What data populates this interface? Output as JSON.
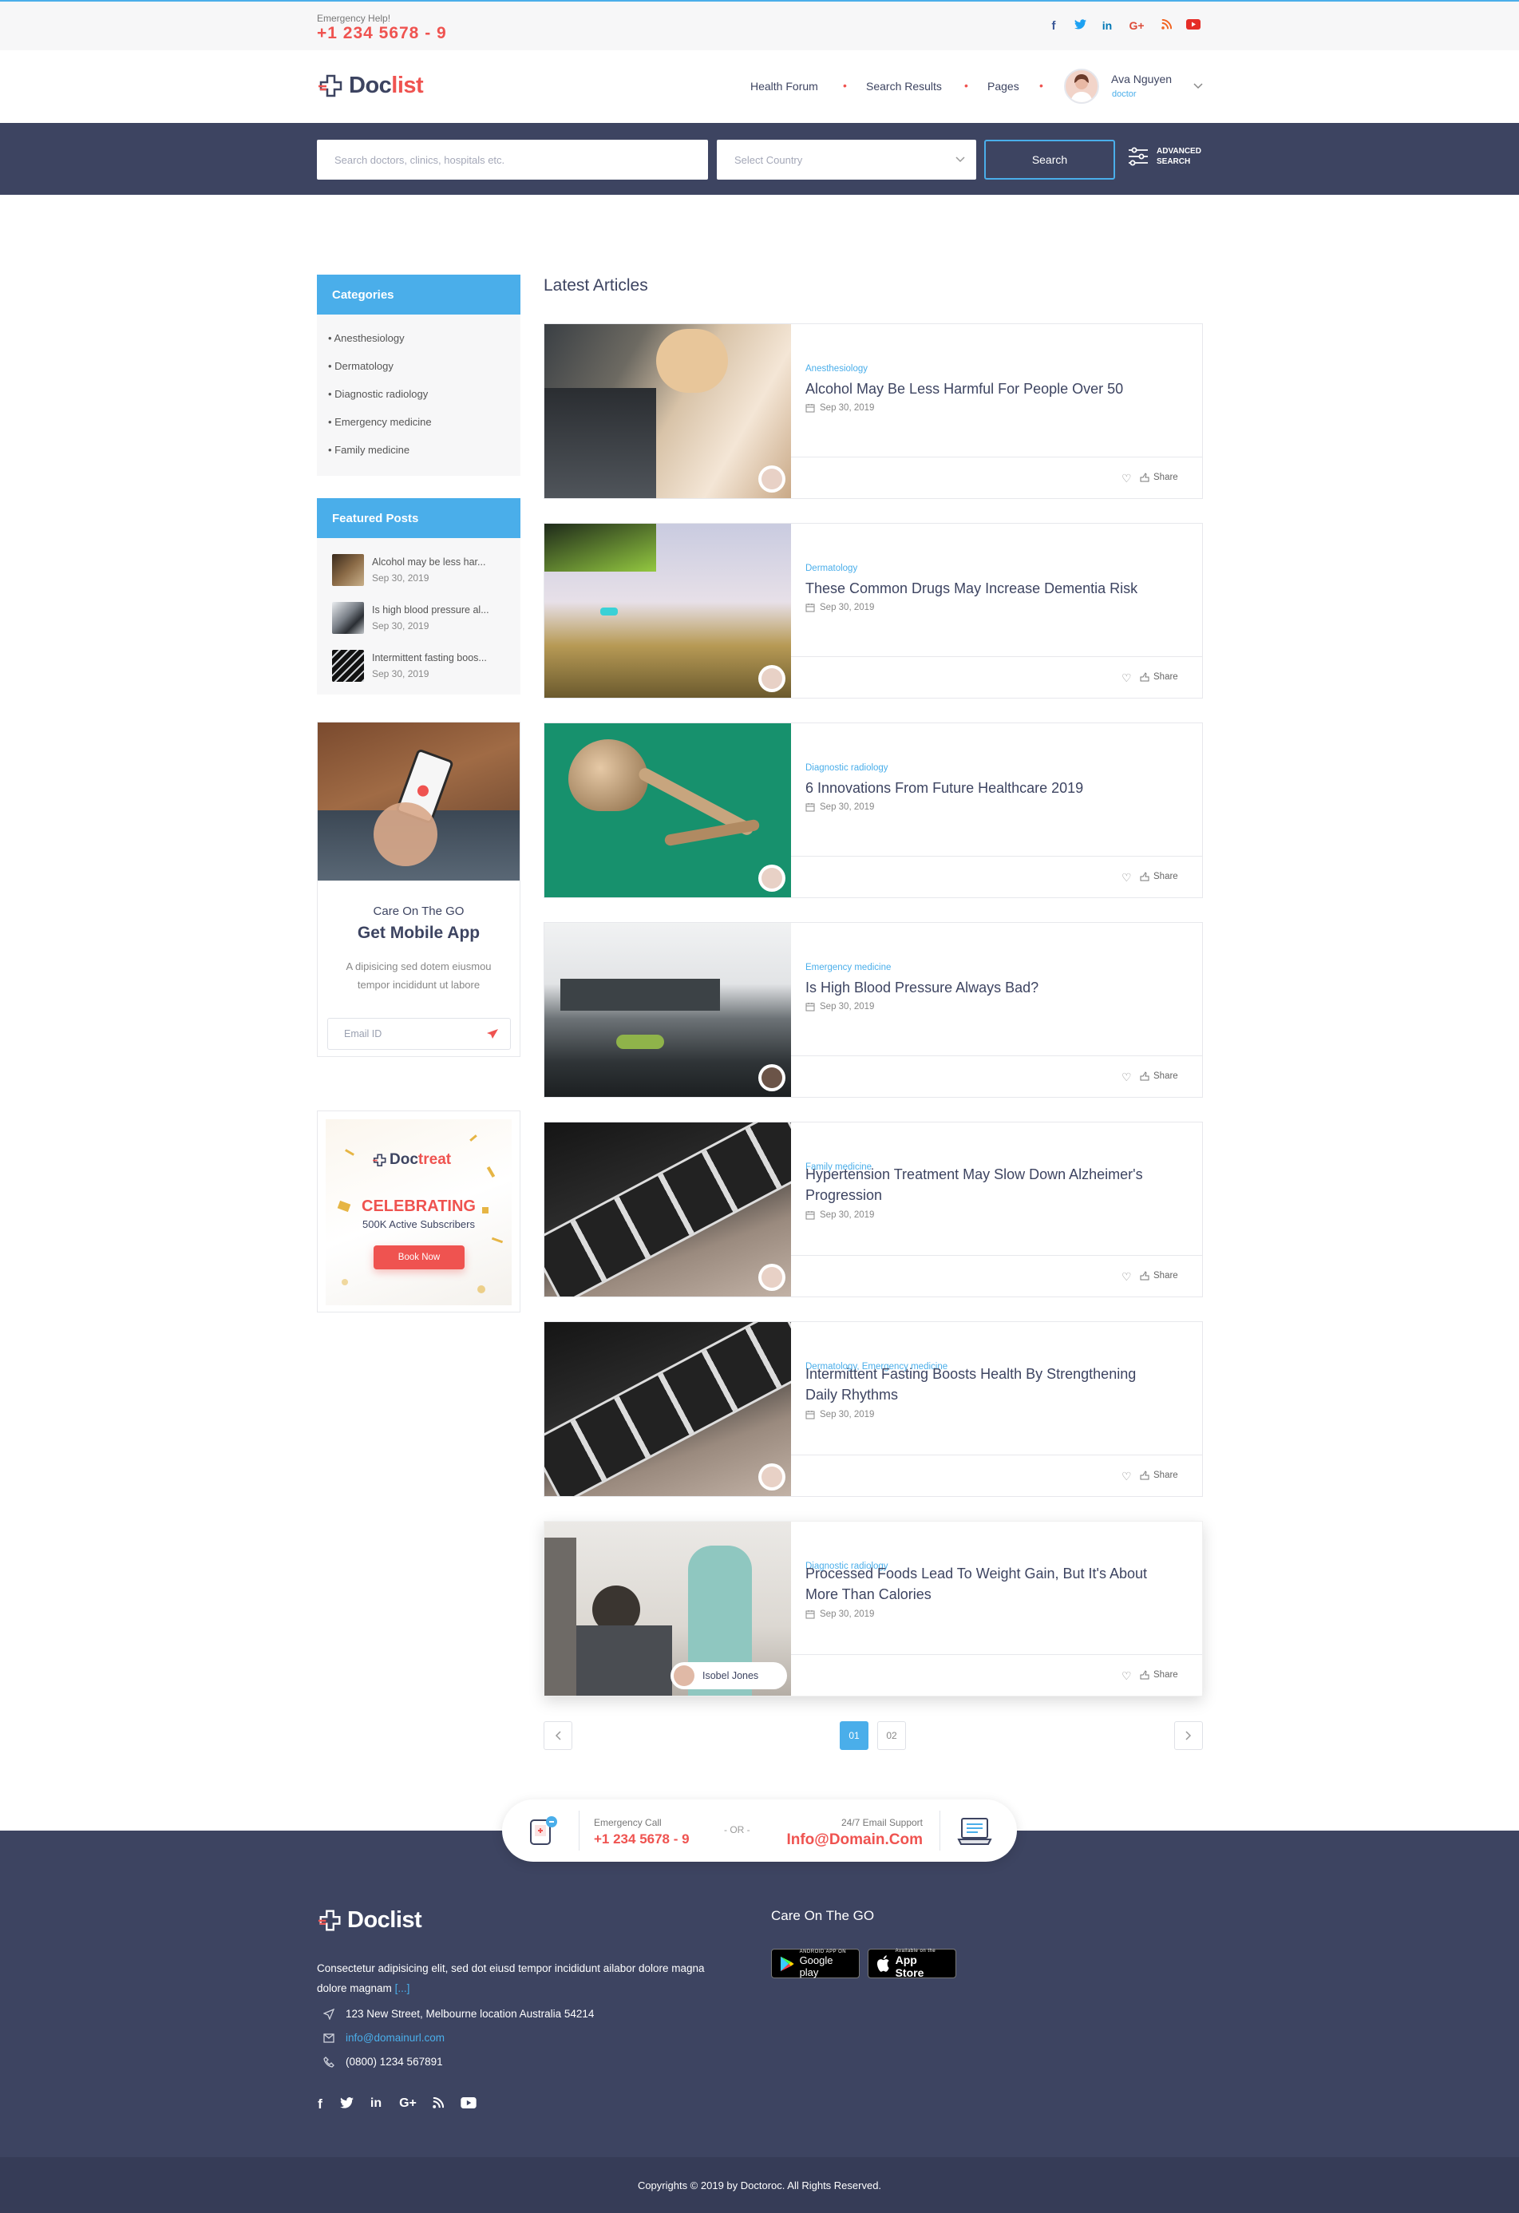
{
  "topbar": {
    "emergency_label": "Emergency Help!",
    "emergency_phone": "+1 234 5678 - 9",
    "social": [
      {
        "icon": "facebook-icon",
        "glyph": "f",
        "color": "#3b5998"
      },
      {
        "icon": "twitter-icon",
        "glyph": "🐦",
        "color": "#1da1f2"
      },
      {
        "icon": "linkedin-icon",
        "glyph": "in",
        "color": "#0077b5"
      },
      {
        "icon": "google-plus-icon",
        "glyph": "G+",
        "color": "#dd4b39"
      },
      {
        "icon": "rss-icon",
        "glyph": "◎",
        "color": "#f26522"
      },
      {
        "icon": "youtube-icon",
        "glyph": "▶",
        "color": "#e52d27"
      }
    ]
  },
  "header": {
    "logo_a": "Doc",
    "logo_b": "list",
    "nav": [
      "Health Forum",
      "Search Results",
      "Pages"
    ],
    "user_name": "Ava Nguyen",
    "user_role": "doctor"
  },
  "search": {
    "placeholder": "Search doctors, clinics, hospitals etc.",
    "country_placeholder": "Select Country",
    "button": "Search",
    "advanced_line1": "ADVANCED",
    "advanced_line2": "SEARCH"
  },
  "sidebar": {
    "categories_title": "Categories",
    "categories": [
      "Anesthesiology",
      "Dermatology",
      "Diagnostic radiology",
      "Emergency medicine",
      "Family medicine"
    ],
    "featured_title": "Featured Posts",
    "featured": [
      {
        "title": "Alcohol may be less har...",
        "date": "Sep 30, 2019"
      },
      {
        "title": "Is high blood pressure al...",
        "date": "Sep 30, 2019"
      },
      {
        "title": "Intermittent fasting boos...",
        "date": "Sep 30, 2019"
      }
    ],
    "app": {
      "pre": "Care On The GO",
      "title": "Get Mobile App",
      "text_1": "A dipisicing sed dotem eiusmou",
      "text_2": "tempor incididunt ut labore",
      "email_placeholder": "Email ID"
    },
    "ad": {
      "logo_a": "Doc",
      "logo_b": "treat",
      "headline": "CELEBRATING",
      "sub": "500K Active Subscribers",
      "button": "Book Now"
    }
  },
  "main": {
    "heading": "Latest Articles",
    "share_label": "Share",
    "articles": [
      {
        "category": "Anesthesiology",
        "title_1": "Alcohol May Be Less Harmful For People Over 50",
        "title_2": "",
        "date": "Sep 30, 2019"
      },
      {
        "category": "Dermatology",
        "title_1": "These Common Drugs May Increase Dementia Risk",
        "title_2": "",
        "date": "Sep 30, 2019"
      },
      {
        "category": "Diagnostic radiology",
        "title_1": "6 Innovations From Future Healthcare 2019",
        "title_2": "",
        "date": "Sep 30, 2019"
      },
      {
        "category": "Emergency medicine",
        "title_1": "Is High Blood Pressure Always Bad?",
        "title_2": "",
        "date": "Sep 30, 2019"
      },
      {
        "category": "Family medicine",
        "title_1": "Hypertension Treatment May Slow Down Alzheimer's",
        "title_2": "Progression",
        "date": "Sep 30, 2019"
      },
      {
        "category": "Dermatology, Emergency medicine",
        "title_1": "Intermittent Fasting Boosts Health By Strengthening",
        "title_2": "Daily Rhythms",
        "date": "Sep 30, 2019"
      },
      {
        "category": "Diagnostic radiology",
        "title_1": "Processed Foods Lead To Weight Gain, But It's About",
        "title_2": "More Than Calories",
        "date": "Sep 30, 2019",
        "author": "Isobel Jones"
      }
    ],
    "pagination": {
      "pages": [
        "01",
        "02"
      ],
      "current": "01"
    }
  },
  "contact_pill": {
    "call_label": "Emergency Call",
    "call_value": "+1 234 5678 - 9",
    "or": "- OR -",
    "email_label": "24/7 Email Support",
    "email_value": "Info@Domain.Com"
  },
  "footer": {
    "logo_a": "Doc",
    "logo_b": "list",
    "about_1": "Consectetur adipisicing elit, sed dot eiusd tempor incididunt ailabor dolore magna",
    "about_2": "dolore magnam",
    "about_more": "[...]",
    "address": "123 New Street, Melbourne location Australia 54214",
    "email": "info@domainurl.com",
    "phone": "(0800) 1234 567891",
    "care_title": "Care On The GO",
    "google_small": "ANDROID APP ON",
    "google_big": "Google play",
    "apple_small": "Available on the",
    "apple_big": "App Store",
    "copyright": "Copyrights © 2019 by Doctoroc. All Rights Reserved."
  }
}
